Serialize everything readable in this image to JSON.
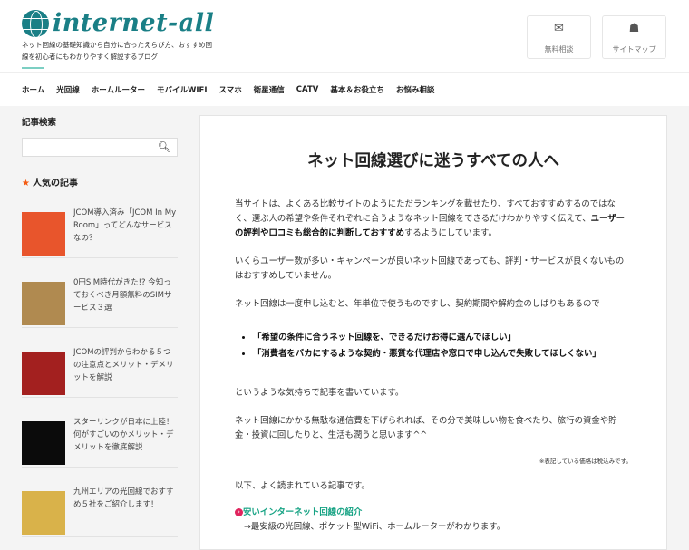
{
  "header": {
    "logo": "internet-all",
    "tagline": "ネット回線の基礎知識から自分に合ったえらび方、おすすめ回線を初心者にもわかりやすく解説するブログ",
    "buttons": [
      {
        "label": "無料相談",
        "icon": "envelope-icon"
      },
      {
        "label": "サイトマップ",
        "icon": "sitemap-icon"
      }
    ]
  },
  "nav": [
    "ホーム",
    "光回線",
    "ホームルーター",
    "モバイルWIFI",
    "スマホ",
    "衛星通信",
    "CATV",
    "基本＆お役立ち",
    "お悩み相談"
  ],
  "sidebar": {
    "search_title": "記事検索",
    "popular_title": "人気の記事",
    "articles": [
      {
        "title": "JCOM導入済み「JCOM In My Room」ってどんなサービスなの？",
        "color": "#e8552c"
      },
      {
        "title": "0円SIM時代がきた!? 今知っておくべき月額無料のSIMサービス３選",
        "color": "#b08a50"
      },
      {
        "title": "JCOMの評判からわかる５つの注意点とメリット・デメリットを解説",
        "color": "#a3201f"
      },
      {
        "title": "スターリンクが日本に上陸！何がすごいのかメリット・デメリットを徹底解説",
        "color": "#0b0b0b"
      },
      {
        "title": "九州エリアの光回線でおすすめ５社をご紹介します！",
        "color": "#d9b24a"
      }
    ]
  },
  "main": {
    "title": "ネット回線選びに迷うすべての人へ",
    "p1a": "当サイトは、よくある比較サイトのようにただランキングを載せたり、すべておすすめするのではなく、選ぶ人の希望や条件それぞれに合うようなネット回線をできるだけわかりやすく伝えて、",
    "p1b": "ユーザーの評判や口コミも総合的に判断しておすすめ",
    "p1c": "するようにしています。",
    "p2": "いくらユーザー数が多い・キャンペーンが良いネット回線であっても、評判・サービスが良くないものはおすすめしていません。",
    "p3": "ネット回線は一度申し込むと、年単位で使うものですし、契約期間や解約金のしばりもあるので",
    "bullets": [
      "「希望の条件に合うネット回線を、できるだけお得に選んでほしい」",
      "「消費者をバカにするような契約・悪質な代理店や窓口で申し込んで失敗してほしくない」"
    ],
    "p4": "というような気持ちで記事を書いています。",
    "p5": "ネット回線にかかる無駄な通信費を下げられれば、その分で美味しい物を食べたり、旅行の資金や貯金・投資に回したりと、生活も潤うと思います^^",
    "note": "※表記している価格は税込みです。",
    "p6": "以下、よく読まれている記事です。",
    "link": "安いインターネット回線の紹介",
    "link_desc": "→最安級の光回線、ポケット型WiFi、ホームルーターがわかります。"
  }
}
